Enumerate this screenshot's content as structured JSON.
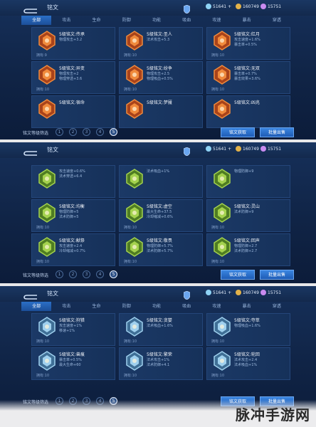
{
  "header": {
    "title": "铭文",
    "currency": [
      {
        "icon": "diamond-icon",
        "value": "51641"
      },
      {
        "icon": "gold-coin-icon",
        "value": "160749"
      },
      {
        "icon": "gem-icon",
        "value": "15751"
      }
    ]
  },
  "tabs": [
    "全部",
    "攻击",
    "生命",
    "防御",
    "功能",
    "吸血",
    "攻速",
    "暴击",
    "穿透"
  ],
  "active_tab": "全部",
  "filter_label": "铭文等级筛选",
  "levels": [
    "1",
    "2",
    "3",
    "4",
    "5"
  ],
  "selected_level": "5",
  "buttons": {
    "get": "铭文获取",
    "sell": "批量出售"
  },
  "panel1": {
    "cards": [
      {
        "name": "5级铭文:传承",
        "stats": [
          "物理攻击+3.2"
        ],
        "owned": "拥有:9",
        "color": "red"
      },
      {
        "name": "5级铭文:圣人",
        "stats": [
          "法术攻击+5.3"
        ],
        "owned": "拥有:10",
        "color": "red"
      },
      {
        "name": "5级铭文:红月",
        "stats": [
          "攻击速度+1.6%",
          "暴击率+0.5%"
        ],
        "owned": "拥有:10",
        "color": "red"
      },
      {
        "name": "5级铭文:异变",
        "stats": [
          "物理攻击+2",
          "物理穿透+3.6"
        ],
        "owned": "拥有:10",
        "color": "red"
      },
      {
        "name": "5级铭文:纷争",
        "stats": [
          "物理攻击+2.5",
          "物理吸血+0.5%"
        ],
        "owned": "拥有:10",
        "color": "red"
      },
      {
        "name": "5级铭文:无双",
        "stats": [
          "暴击率+0.7%",
          "暴击效果+3.6%"
        ],
        "owned": "拥有:10",
        "color": "red"
      },
      {
        "name": "5级铭文:宿命",
        "stats": [],
        "owned": "",
        "color": "red"
      },
      {
        "name": "5级铭文:梦魇",
        "stats": [],
        "owned": "",
        "color": "red"
      },
      {
        "name": "5级铭文:凶兆",
        "stats": [],
        "owned": "",
        "color": "red"
      }
    ]
  },
  "panel2": {
    "cards": [
      {
        "name": "",
        "stats": [
          "攻击速度+0.6%",
          "法术穿透+6.4"
        ],
        "owned": "",
        "color": "green"
      },
      {
        "name": "",
        "stats": [
          "法术吸血+1%"
        ],
        "owned": "",
        "color": "green"
      },
      {
        "name": "",
        "stats": [
          "物理防御+9"
        ],
        "owned": "",
        "color": "green"
      },
      {
        "name": "5级铭文:均衡",
        "stats": [
          "物理防御+5",
          "法术防御+5"
        ],
        "owned": "拥有:10",
        "color": "green"
      },
      {
        "name": "5级铭文:虚空",
        "stats": [
          "最大生命+37.5",
          "冷却缩减+0.6%"
        ],
        "owned": "拥有:10",
        "color": "green"
      },
      {
        "name": "5级铭文:灵山",
        "stats": [
          "法术防御+9"
        ],
        "owned": "拥有:10",
        "color": "green"
      },
      {
        "name": "5级铭文:献祭",
        "stats": [
          "攻击速度+2.4",
          "冷却缩减+0.7%"
        ],
        "owned": "拥有:10",
        "color": "green"
      },
      {
        "name": "5级铭文:敬畏",
        "stats": [
          "物理防御+5.7%",
          "法术防御+5.7%"
        ],
        "owned": "拥有:10",
        "color": "green"
      },
      {
        "name": "5级铭文:回声",
        "stats": [
          "物理防御+2.7",
          "法术防御+2.7"
        ],
        "owned": "拥有:10",
        "color": "green"
      }
    ]
  },
  "panel3": {
    "cards": [
      {
        "name": "5级铭文:狩猎",
        "stats": [
          "攻击速度+1%",
          "移速+1%"
        ],
        "owned": "拥有:10",
        "color": "blue"
      },
      {
        "name": "5级铭文:贪婪",
        "stats": [
          "法术吸血+1.6%"
        ],
        "owned": "拥有:10",
        "color": "blue"
      },
      {
        "name": "5级铭文:夺萃",
        "stats": [
          "物理吸血+1.6%"
        ],
        "owned": "拥有:10",
        "color": "blue"
      },
      {
        "name": "5级铭文:兽痕",
        "stats": [
          "暴击率+0.5%",
          "最大生命+60"
        ],
        "owned": "拥有:10",
        "color": "blue"
      },
      {
        "name": "5级铭文:繁荣",
        "stats": [
          "法术攻击+1%",
          "法术防御+4.1"
        ],
        "owned": "拥有:10",
        "color": "blue"
      },
      {
        "name": "5级铭文:轮回",
        "stats": [
          "法术攻击+2.4",
          "法术吸血+1%"
        ],
        "owned": "拥有:10",
        "color": "blue"
      }
    ]
  },
  "watermark": "脉冲手游网",
  "colors": {
    "red": "#d9682a",
    "green": "#7fb23a",
    "blue": "#6aa0c8",
    "accent": "#2b6fc7"
  }
}
